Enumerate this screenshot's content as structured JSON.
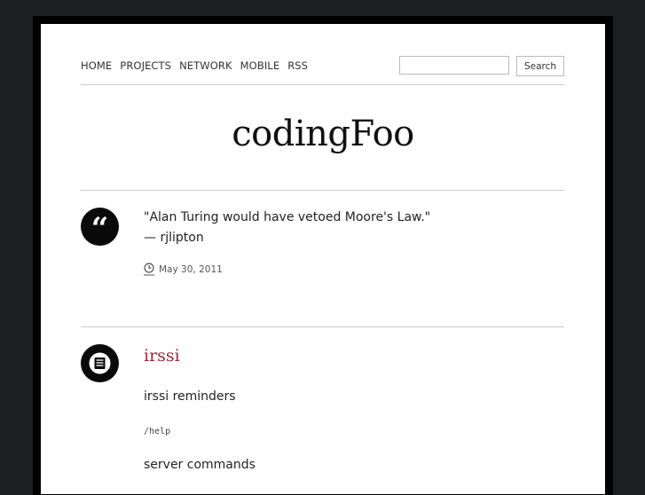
{
  "nav": {
    "items": [
      {
        "label": "HOME"
      },
      {
        "label": "PROJECTS"
      },
      {
        "label": "NETWORK"
      },
      {
        "label": "MOBILE"
      },
      {
        "label": "RSS"
      }
    ],
    "search": {
      "value": "",
      "placeholder": "",
      "button_label": "Search"
    }
  },
  "site": {
    "title": "codingFoo"
  },
  "posts": [
    {
      "type_icon": "quote-icon",
      "quote": "\"Alan Turing would have vetoed Moore's Law.\"",
      "attribution": "— rjlipton",
      "date": "May 30, 2011"
    },
    {
      "type_icon": "list-icon",
      "title": "irssi",
      "paragraph1": "irssi reminders",
      "code": "/help",
      "paragraph2": "server commands"
    }
  ]
}
